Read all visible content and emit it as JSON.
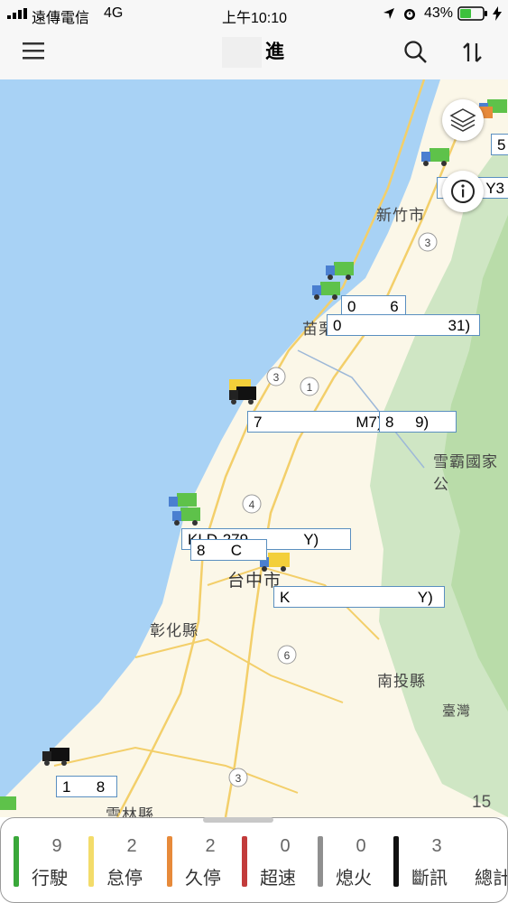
{
  "status_bar": {
    "carrier": "遠傳電信",
    "network": "4G",
    "time": "上午10:10",
    "battery": "43%"
  },
  "nav": {
    "title": "進",
    "menu_icon": "hamburger-menu-icon",
    "search_icon": "search-icon",
    "sort_icon": "sort-arrows-icon"
  },
  "map": {
    "places": {
      "hsinchu": "新竹市",
      "miaoli": "苗栗縣",
      "shei_pa": "雪霸國家公",
      "taichung": "台中市",
      "changhua": "彰化縣",
      "nantou": "南投縣",
      "taiwan": "臺灣",
      "yunlin": "雲林縣"
    },
    "road_shields": {
      "s1": "3",
      "s2": "1",
      "s3": "3",
      "s4": "4",
      "s5": "6",
      "s6": "3"
    },
    "vehicle_labels": {
      "l1": "5",
      "l2": "Y3",
      "l3": "0        6",
      "l4": "0                         31)",
      "l5": "7                      M7)",
      "l6": "8     9)",
      "l7": "KLD-279             Y)",
      "l8": "8      C",
      "l9": "K                              Y)",
      "l10": "1      8"
    },
    "zoom_level": "15",
    "layers_icon": "layers-icon",
    "info_icon": "info-icon"
  },
  "legend": {
    "items": [
      {
        "count": "9",
        "label": "行駛",
        "color": "#3aa83a"
      },
      {
        "count": "2",
        "label": "怠停",
        "color": "#f3dc6a"
      },
      {
        "count": "2",
        "label": "久停",
        "color": "#e78a3a"
      },
      {
        "count": "0",
        "label": "超速",
        "color": "#c23b3b"
      },
      {
        "count": "0",
        "label": "熄火",
        "color": "#8f8f8f"
      },
      {
        "count": "3",
        "label": "斷訊",
        "color": "#111111"
      },
      {
        "count": "",
        "label": "總計",
        "color": ""
      }
    ]
  }
}
